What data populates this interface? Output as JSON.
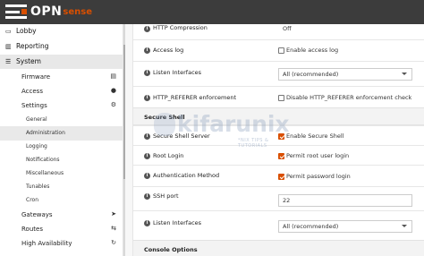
{
  "brand": {
    "name": "OPN",
    "suffix": "sense",
    "accent_color": "#d94f00"
  },
  "sidebar": {
    "top_items": [
      {
        "label": "Lobby",
        "icon": "laptop-icon"
      },
      {
        "label": "Reporting",
        "icon": "chart-icon"
      },
      {
        "label": "System",
        "icon": "server-icon"
      }
    ],
    "system_items": [
      {
        "label": "Firmware",
        "icon": "archive-icon"
      },
      {
        "label": "Access",
        "icon": "users-icon"
      },
      {
        "label": "Settings",
        "icon": "cogs-icon"
      }
    ],
    "settings_items": [
      {
        "label": "General"
      },
      {
        "label": "Administration"
      },
      {
        "label": "Logging"
      },
      {
        "label": "Notifications"
      },
      {
        "label": "Miscellaneous"
      },
      {
        "label": "Tunables"
      },
      {
        "label": "Cron"
      }
    ],
    "bottom_items": [
      {
        "label": "Gateways",
        "icon": "location-arrow-icon"
      },
      {
        "label": "Routes",
        "icon": "signpost-icon"
      },
      {
        "label": "High Availability",
        "icon": "refresh-icon"
      }
    ]
  },
  "main": {
    "top_partial": {
      "label": "HTTP Compression",
      "value": "Off"
    },
    "rows": [
      {
        "label": "Access log",
        "checkbox_label": "Enable access log",
        "checked": false
      },
      {
        "label": "Listen Interfaces",
        "select_value": "All (recommended)"
      },
      {
        "label": "HTTP_REFERER enforcement",
        "checkbox_label": "Disable HTTP_REFERER enforcement check",
        "checked": false
      }
    ],
    "ssh_section": {
      "title": "Secure Shell",
      "rows": [
        {
          "label": "Secure Shell Server",
          "checkbox_label": "Enable Secure Shell",
          "checked": true
        },
        {
          "label": "Root Login",
          "checkbox_label": "Permit root user login",
          "checked": true
        },
        {
          "label": "Authentication Method",
          "checkbox_label": "Permit password login",
          "checked": true
        },
        {
          "label": "SSH port",
          "field_value": "22"
        },
        {
          "label": "Listen Interfaces",
          "select_value": "All (recommended)"
        }
      ]
    },
    "console_section": {
      "title": "Console Options"
    }
  },
  "watermark": {
    "main": "kifarunix",
    "sub": "*NIX TIPS & TUTORIALS"
  }
}
